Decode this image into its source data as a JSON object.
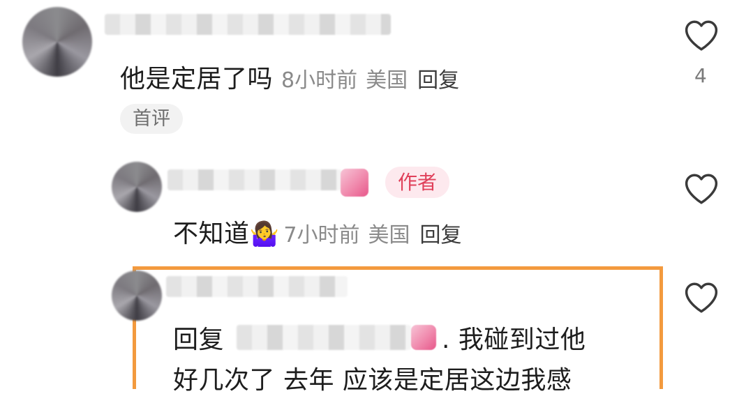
{
  "comments": [
    {
      "text": "他是定居了吗",
      "time": "8小时前",
      "region": "美国",
      "reply": "回复",
      "badge": "首评",
      "likes": "4"
    },
    {
      "text": "不知道",
      "emoji": "🤷‍♀️",
      "time": "7小时前",
      "region": "美国",
      "reply": "回复",
      "badge": "作者"
    },
    {
      "reply_prefix": "回复",
      "line1_tail": ". 我碰到过他",
      "line2": "好几次了 去年 应该是定居这边我感"
    }
  ],
  "icons": {
    "like": "heart-outline-icon"
  },
  "colors": {
    "highlight_border": "#f39a3e",
    "author_badge_text": "#e0405a",
    "author_badge_bg": "#fde9ee"
  }
}
